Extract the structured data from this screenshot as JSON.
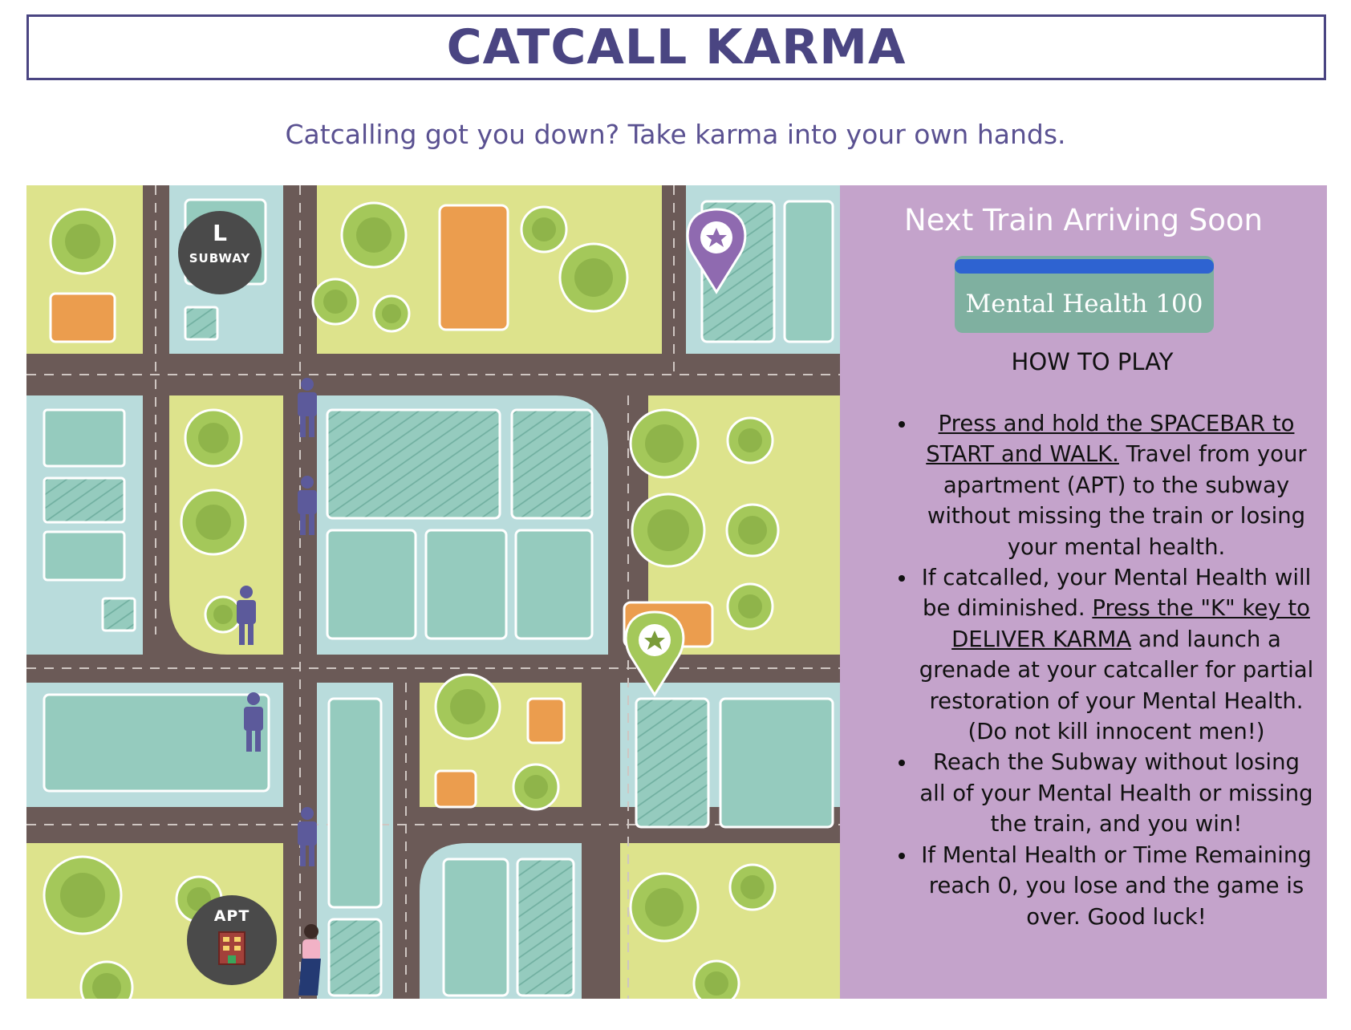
{
  "header": {
    "title": "CATCALL KARMA"
  },
  "tagline": "Catcalling got you down? Take karma into your own hands.",
  "map": {
    "subway_badge": {
      "line": "L",
      "label": "SUBWAY"
    },
    "apt_badge": {
      "label": "APT"
    },
    "markers": [
      "purple-star-pin-icon",
      "green-star-pin-icon"
    ],
    "pedestrian_count": 5,
    "colors": {
      "road": "#6b5a57",
      "park": "#dde38c",
      "plaza": "#b9dcdc",
      "building": "#95cbbe",
      "orange_lot": "#eb9d4e",
      "tree": "#a4c85a"
    }
  },
  "panel": {
    "timer_label": "Next Train Arriving Soon",
    "health_label": "Mental Health 100",
    "health_value": 100,
    "health_max": 100,
    "how_to_title": "HOW TO PLAY",
    "rules": [
      {
        "parts": [
          {
            "text": "Press and hold the SPACEBAR to START and WALK.",
            "underline": true
          },
          {
            "text": " Travel from your apartment (APT) to the subway without missing the train or losing your mental health.",
            "underline": false
          }
        ]
      },
      {
        "parts": [
          {
            "text": "If catcalled, your Mental Health will be diminished. ",
            "underline": false
          },
          {
            "text": "Press the \"K\" key to DELIVER KARMA",
            "underline": true
          },
          {
            "text": " and launch a grenade at your catcaller for partial restoration of your Mental Health. (Do not kill innocent men!)",
            "underline": false
          }
        ]
      },
      {
        "parts": [
          {
            "text": "Reach the Subway without losing all of your Mental Health or missing the train, and you win!",
            "underline": false
          }
        ]
      },
      {
        "parts": [
          {
            "text": "If Mental Health or Time Remaining reach 0, you lose and the game is over. Good luck!",
            "underline": false
          }
        ]
      }
    ],
    "colors": {
      "panel_bg": "#c4a3cb",
      "health_box": "#7fb0a0",
      "health_bar": "#2e63d1"
    }
  }
}
